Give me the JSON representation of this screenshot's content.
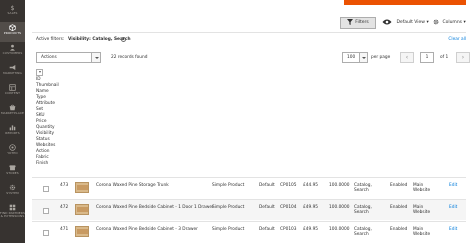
{
  "sidebar": {
    "items": [
      {
        "label": "Sales",
        "icon": "dollar-icon"
      },
      {
        "label": "Products",
        "icon": "cube-icon",
        "active": true
      },
      {
        "label": "Customers",
        "icon": "person-icon"
      },
      {
        "label": "Marketing",
        "icon": "megaphone-icon"
      },
      {
        "label": "Content",
        "icon": "layout-icon"
      },
      {
        "label": "Marketplace",
        "icon": "store-icon"
      },
      {
        "label": "Reports",
        "icon": "bar-chart-icon"
      },
      {
        "label": "Yotpo",
        "icon": "star-icon"
      },
      {
        "label": "Stores",
        "icon": "storefront-icon"
      },
      {
        "label": "System",
        "icon": "gear-icon"
      },
      {
        "label": "Find Partners & Extensions",
        "icon": "partners-icon"
      }
    ]
  },
  "toolbar": {
    "filters_label": "Filters",
    "view_label": "Default View",
    "columns_label": "Columns"
  },
  "active_filters": {
    "label": "Active filters:",
    "value": "Visibility: Catalog, Search",
    "clear_label": "Clear all"
  },
  "actions": {
    "select_label": "Actions",
    "records_found": "22 records found"
  },
  "pagination": {
    "per_page_value": "100",
    "per_page_label": "per page",
    "page_value": "1",
    "of_label": "of 1"
  },
  "column_list": [
    "ID",
    "Thumbnail",
    "Name",
    "Type",
    "Attribute",
    "Set",
    "SKU",
    "Price",
    "Quantity",
    "Visibility",
    "Status",
    "Websites",
    "Action",
    "Fabric",
    "Finish"
  ],
  "rows": [
    {
      "id": "473",
      "name": "Corona Waxed Pine Storage Trunk",
      "type": "Simple Product",
      "attr_set": "Default",
      "sku": "CP0105",
      "price": "£44.95",
      "qty": "100.0000",
      "visibility": [
        "Catalog,",
        "Search"
      ],
      "status": "Enabled",
      "websites": [
        "Main",
        "Website"
      ],
      "action": "Edit"
    },
    {
      "id": "472",
      "name": "Corona Waxed Pine Bedside Cabinet - 1 Door 1 Drawer",
      "type": "Simple Product",
      "attr_set": "Default",
      "sku": "CP0104",
      "price": "£49.95",
      "qty": "100.0000",
      "visibility": [
        "Catalog,",
        "Search"
      ],
      "status": "Enabled",
      "websites": [
        "Main",
        "Website"
      ],
      "action": "Edit"
    },
    {
      "id": "471",
      "name": "Corona Waxed Pine Bedside Cabinet - 3 Drawer",
      "type": "Simple Product",
      "attr_set": "Default",
      "sku": "CP0103",
      "price": "£49.95",
      "qty": "100.0000",
      "visibility": [
        "Catalog,",
        "Search"
      ],
      "status": "Enabled",
      "websites": [
        "Main",
        "Website"
      ],
      "action": "Edit"
    }
  ],
  "colors": {
    "sidebar_bg": "#373330",
    "accent": "#eb5202",
    "link": "#007bdb"
  }
}
